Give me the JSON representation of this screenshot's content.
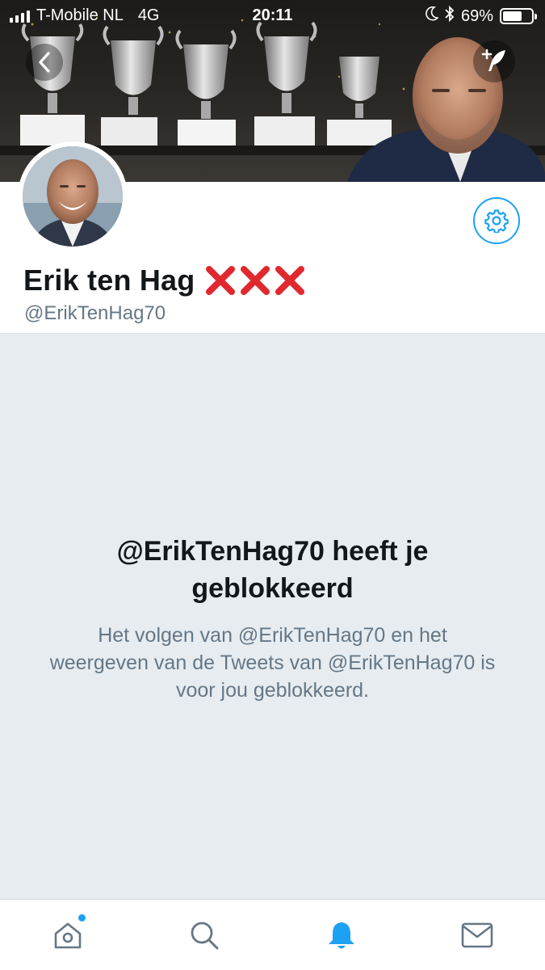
{
  "status_bar": {
    "carrier": "T-Mobile NL",
    "network": "4G",
    "time": "20:11",
    "battery_percent": "69%",
    "battery_level": 0.69
  },
  "header": {
    "back_icon": "chevron-left-icon",
    "compose_icon": "compose-tweet-icon"
  },
  "profile": {
    "display_name": "Erik ten Hag",
    "name_emoji": "❌❌❌",
    "handle": "@ErikTenHag70",
    "settings_icon": "gear-icon"
  },
  "blocked": {
    "title": "@ErikTenHag70 heeft je geblokkeerd",
    "message": "Het volgen van @ErikTenHag70 en het weergeven van de Tweets van @ErikTenHag70 is voor jou geblokkeerd."
  },
  "tabs": [
    {
      "icon": "home-icon",
      "active": false,
      "has_badge": true
    },
    {
      "icon": "search-icon",
      "active": false,
      "has_badge": false
    },
    {
      "icon": "bell-icon",
      "active": true,
      "has_badge": false
    },
    {
      "icon": "mail-icon",
      "active": false,
      "has_badge": false
    }
  ],
  "colors": {
    "accent": "#1da1f2",
    "blocked_bg": "#e6ecf0",
    "secondary_text": "#657786",
    "primary_text": "#14171a",
    "x_red": "#e0292f"
  }
}
